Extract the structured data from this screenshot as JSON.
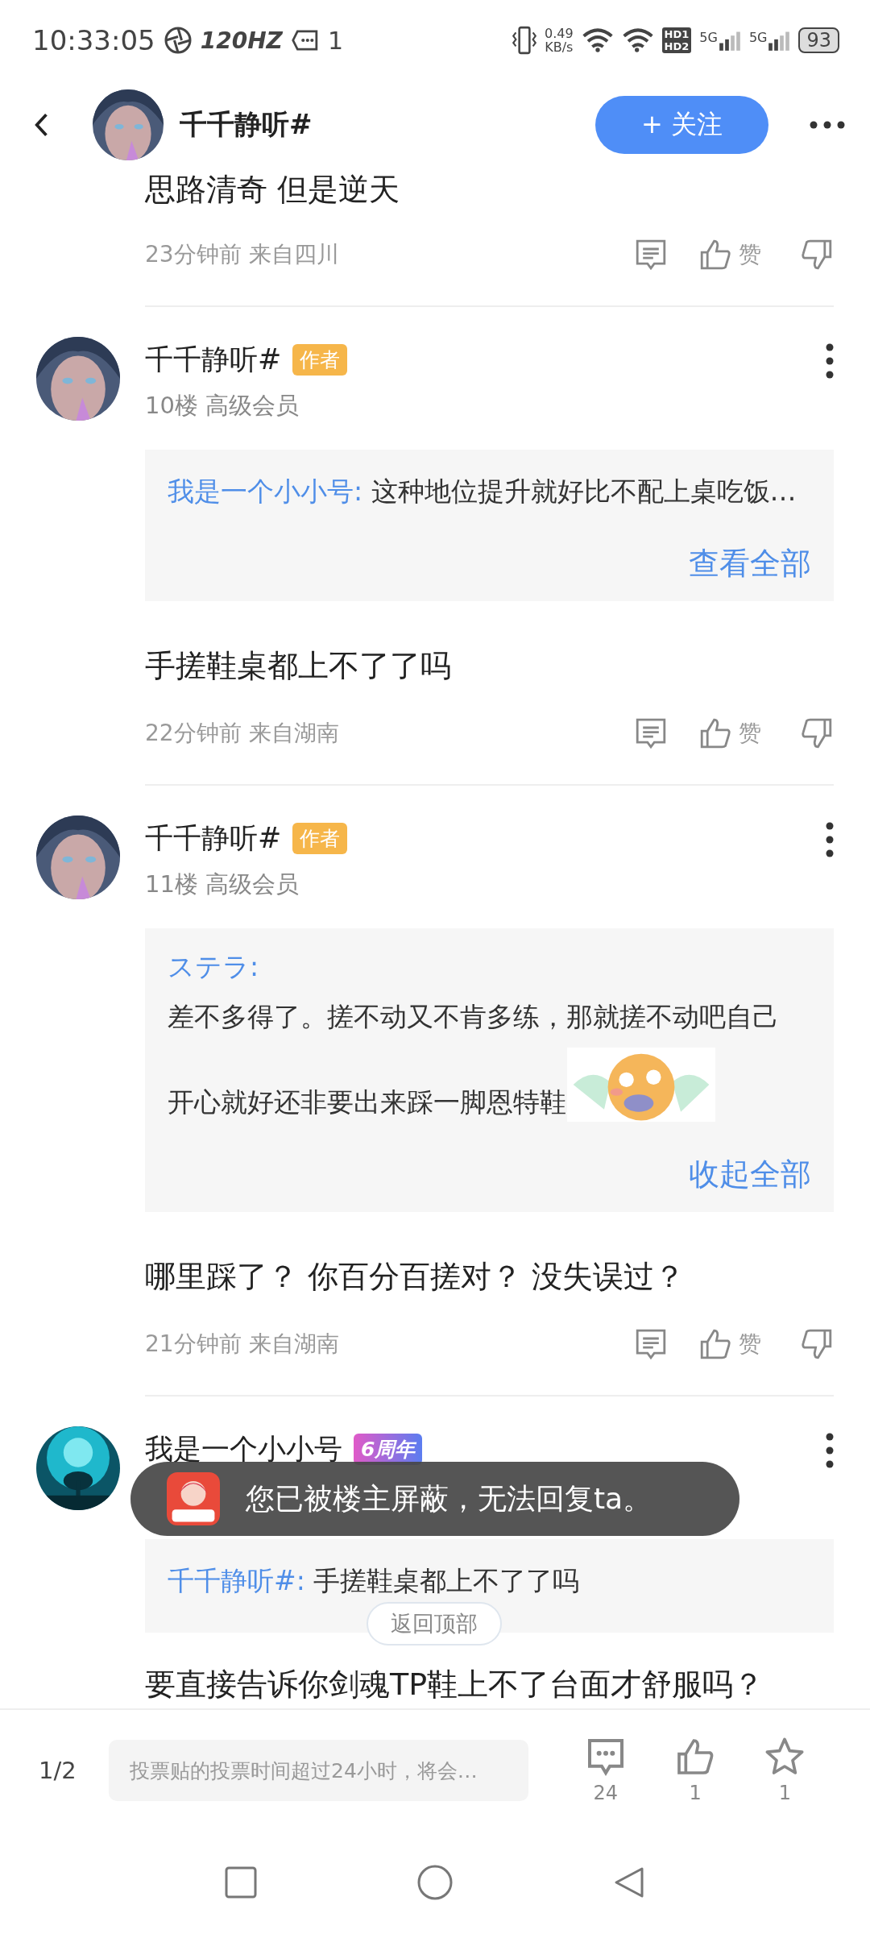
{
  "status_bar": {
    "time": "10:33:05",
    "refresh_rate": "120HZ",
    "notification_count": "1",
    "net_speed": "0.49",
    "net_unit": "KB/s",
    "hd_top": "HD1",
    "hd_bottom": "HD2",
    "signals": [
      "5G",
      "5G"
    ],
    "battery": "93"
  },
  "header": {
    "title": "千千静听#",
    "follow_button": "+ 关注"
  },
  "top_comment": {
    "text": "思路清奇 但是逆天",
    "meta": "23分钟前 来自四川",
    "like_label": "赞"
  },
  "posts": [
    {
      "author": "千千静听#",
      "badge": {
        "kind": "author",
        "text": "作者"
      },
      "floor": "10楼 高级会员",
      "quote": {
        "author": "我是一个小小号:",
        "lines": [
          "这种地位提升就好比不配上桌吃饭…"
        ],
        "sticker": false,
        "action": "查看全部"
      },
      "text": "手搓鞋桌都上不了了吗",
      "meta": "22分钟前 来自湖南",
      "like_label": "赞"
    },
    {
      "author": "千千静听#",
      "badge": {
        "kind": "author",
        "text": "作者"
      },
      "floor": "11楼 高级会员",
      "quote": {
        "author": "ステラ:",
        "lines": [
          "差不多得了。搓不动又不肯多练，那就搓不动吧自己",
          "开心就好还非要出来踩一脚恩特鞋"
        ],
        "sticker": true,
        "action": "收起全部"
      },
      "text": "哪里踩了？ 你百分百搓对？ 没失误过？",
      "meta": "21分钟前 来自湖南",
      "like_label": "赞"
    },
    {
      "author": "我是一个小小号",
      "badge": {
        "kind": "anniversary",
        "text": "6周年"
      },
      "quote": {
        "author": "千千静听#:",
        "lines": [
          "手搓鞋桌都上不了了吗"
        ],
        "sticker": false
      },
      "text": "要直接告诉你剑魂TP鞋上不了台面才舒服吗？"
    }
  ],
  "toast": {
    "text": "您已被楼主屏蔽，无法回复ta。"
  },
  "back_to_top": "返回顶部",
  "bottom_bar": {
    "page": "1/2",
    "placeholder": "投票贴的投票时间超过24小时，将会…",
    "comment_count": "24",
    "like_count": "1",
    "favorite_count": "1"
  }
}
